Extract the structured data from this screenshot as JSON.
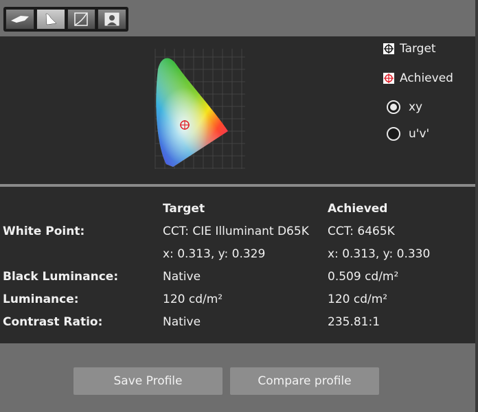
{
  "toolbar": {
    "buttons": [
      {
        "icon": "gamut-icon"
      },
      {
        "icon": "white-point-icon",
        "active": true
      },
      {
        "icon": "curve-icon"
      },
      {
        "icon": "profile-image-icon"
      }
    ]
  },
  "legend": {
    "target_label": "Target",
    "achieved_label": "Achieved"
  },
  "colorspace": {
    "options": [
      {
        "label": "xy",
        "selected": true
      },
      {
        "label": "u'v'",
        "selected": false
      }
    ]
  },
  "table": {
    "headers": {
      "target": "Target",
      "achieved": "Achieved"
    },
    "rows": [
      {
        "label": "White Point:",
        "target": "CCT: CIE Illuminant D65K",
        "achieved": "CCT: 6465K"
      },
      {
        "label": "",
        "target": "x: 0.313, y: 0.329",
        "achieved": "x: 0.313, y: 0.330"
      },
      {
        "label": "Black Luminance:",
        "target": "Native",
        "achieved": "0.509 cd/m²"
      },
      {
        "label": "Luminance:",
        "target": "120 cd/m²",
        "achieved": "120 cd/m²"
      },
      {
        "label": "Contrast Ratio:",
        "target": "Native",
        "achieved": "235.81:1"
      }
    ]
  },
  "actions": {
    "save_label": "Save Profile",
    "compare_label": "Compare profile"
  },
  "colors": {
    "panel_bg": "#2b2b2b",
    "frame_bg": "#6e6e6e",
    "button_bg": "#8d8d8d",
    "achieved_marker": "#e0202a"
  }
}
